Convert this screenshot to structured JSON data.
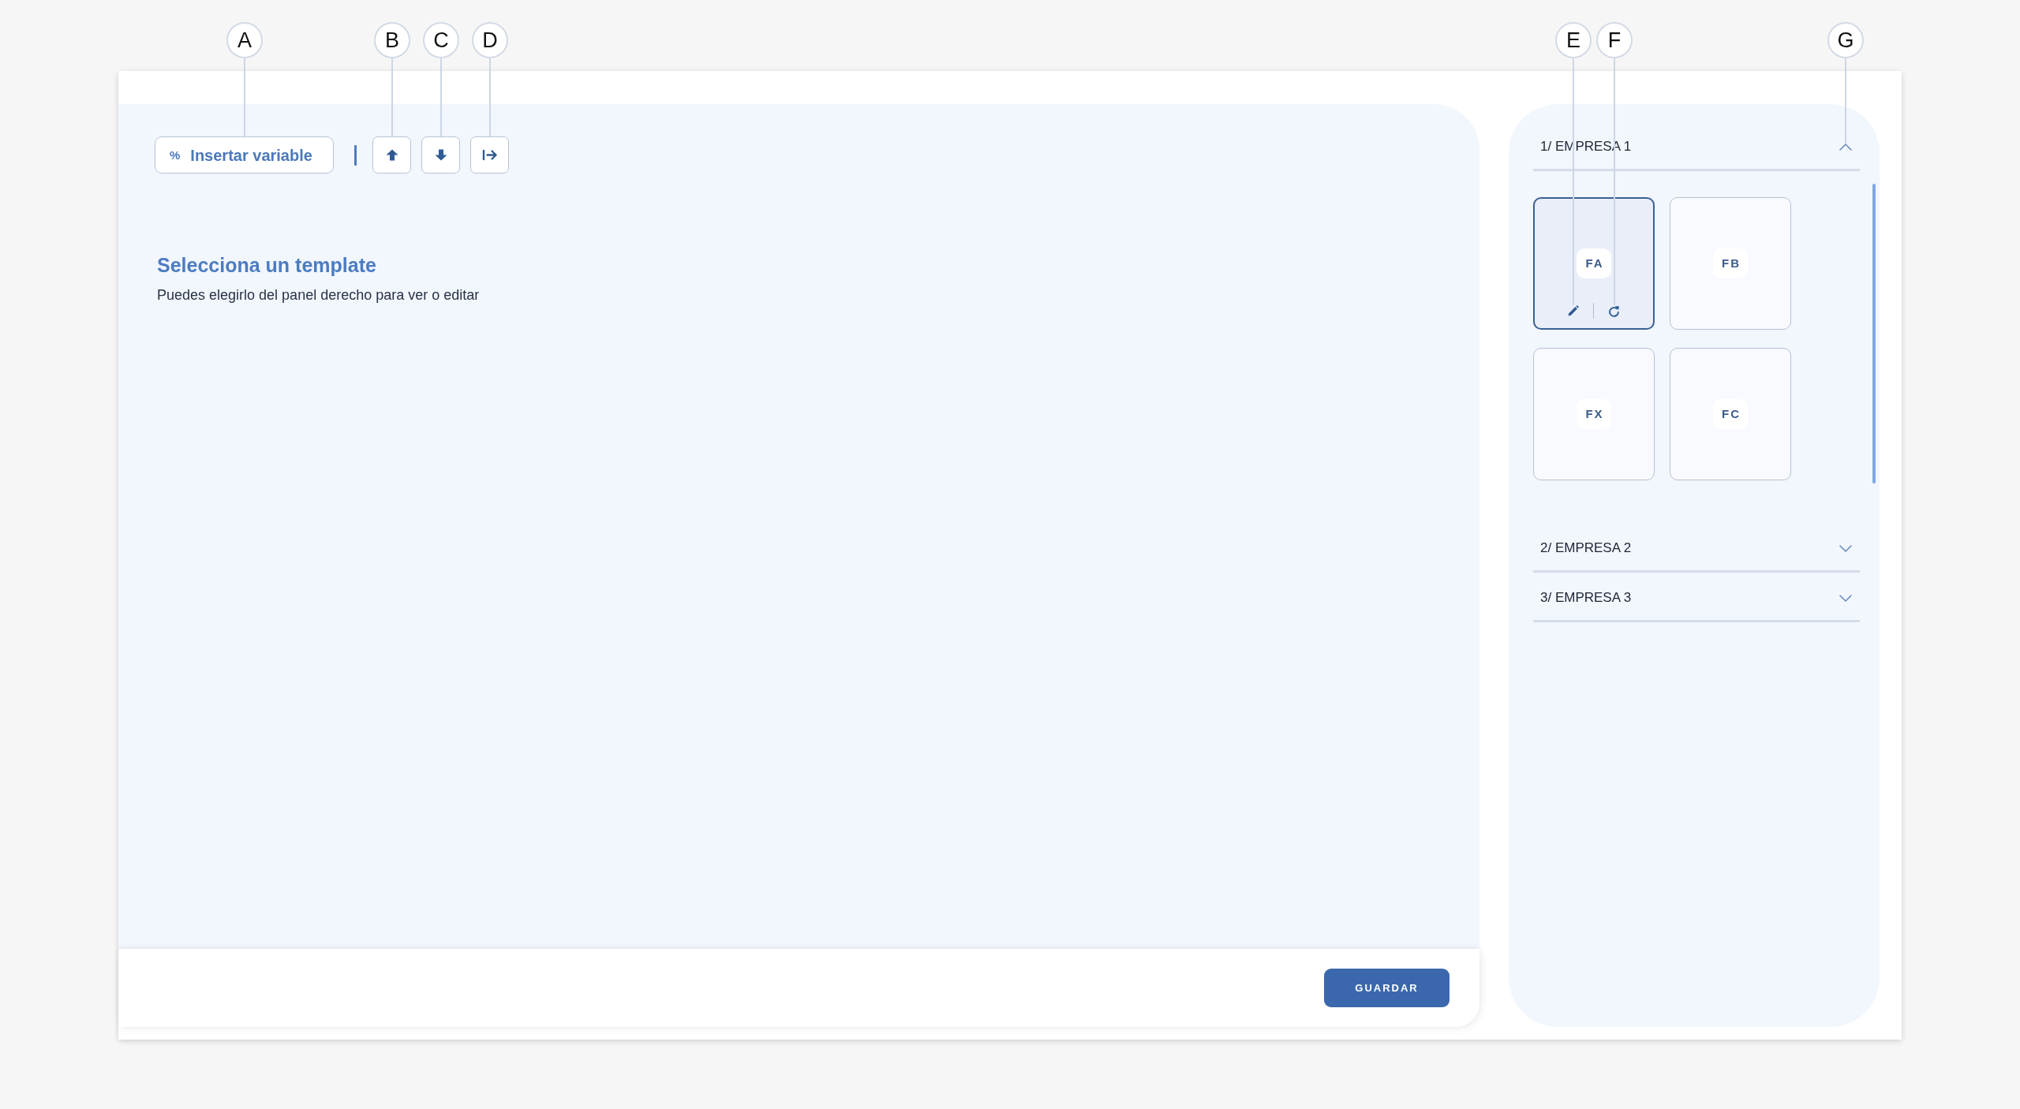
{
  "editor": {
    "toolbar": {
      "insert_variable": {
        "symbol": "%",
        "label": "Insertar variable",
        "callout": "A"
      },
      "icon_buttons": [
        {
          "kind": "move_up",
          "callout": "B"
        },
        {
          "kind": "move_down",
          "callout": "C"
        },
        {
          "kind": "indent",
          "callout": "D"
        }
      ]
    },
    "empty_state": {
      "title": "Selecciona un template",
      "subtitle": "Puedes elegirlo del panel derecho para ver o editar"
    },
    "footer": {
      "save_button": "GUARDAR"
    }
  },
  "template_panel": {
    "sections": [
      {
        "title": "1/ EMPRESA 1",
        "expanded": true,
        "callout": "G",
        "templates": [
          {
            "code": "FA",
            "selected": true,
            "actions": [
              {
                "kind": "edit",
                "callout": "E"
              },
              {
                "kind": "reset",
                "callout": "F"
              }
            ]
          },
          {
            "code": "FB",
            "selected": false
          },
          {
            "code": "FX",
            "selected": false
          },
          {
            "code": "FC",
            "selected": false
          }
        ]
      },
      {
        "title": "2/ EMPRESA 2",
        "expanded": false
      },
      {
        "title": "3/ EMPRESA 3",
        "expanded": false
      }
    ]
  }
}
